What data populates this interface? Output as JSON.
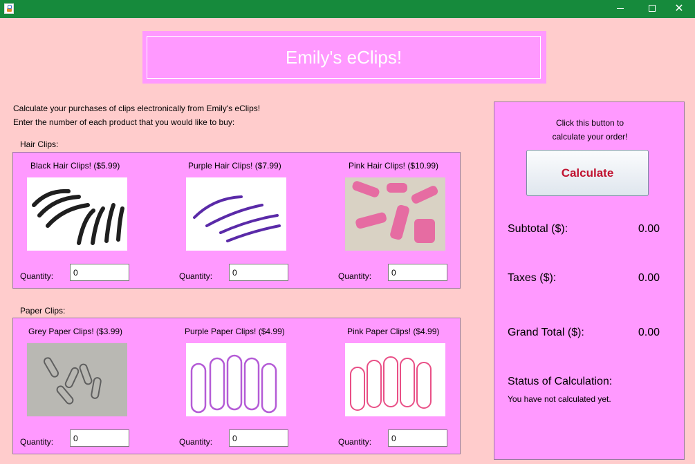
{
  "window": {
    "min_glyph": "",
    "max_glyph": "",
    "close_glyph": "✕"
  },
  "banner": {
    "title": "Emily's eClips!"
  },
  "instructions": {
    "line1": "Calculate your purchases of clips electronically from Emily's eClips!",
    "line2": "Enter the number of each product that you would like to buy:"
  },
  "hair": {
    "section_label": "Hair Clips:",
    "products": [
      {
        "label": "Black Hair Clips! ($5.99)",
        "qty_label": "Quantity:",
        "qty": "0",
        "color": "#1f1f1f"
      },
      {
        "label": "Purple Hair Clips! ($7.99)",
        "qty_label": "Quantity:",
        "qty": "0",
        "color": "#5a2aa8"
      },
      {
        "label": "Pink Hair Clips! ($10.99)",
        "qty_label": "Quantity:",
        "qty": "0",
        "color": "#e8629f"
      }
    ]
  },
  "paper": {
    "section_label": "Paper Clips:",
    "products": [
      {
        "label": "Grey Paper Clips! ($3.99)",
        "qty_label": "Quantity:",
        "qty": "0",
        "color": "#9a9a9a"
      },
      {
        "label": "Purple Paper Clips! ($4.99)",
        "qty_label": "Quantity:",
        "qty": "0",
        "color": "#b45bd6"
      },
      {
        "label": "Pink Paper Clips! ($4.99)",
        "qty_label": "Quantity:",
        "qty": "0",
        "color": "#e94f86"
      }
    ]
  },
  "calc": {
    "hint_line1": "Click this button to",
    "hint_line2": "calculate your order!",
    "button": "Calculate",
    "subtotal_label": "Subtotal ($):",
    "subtotal": "0.00",
    "taxes_label": "Taxes ($):",
    "taxes": "0.00",
    "grand_label": "Grand Total ($):",
    "grand": "0.00",
    "status_label": "Status of Calculation:",
    "status_msg": "You have not calculated yet."
  },
  "colors": {
    "background": "#ffcccc",
    "panel": "#ff99ff",
    "titlebar": "#168a3c",
    "button_text": "#c0112f"
  }
}
